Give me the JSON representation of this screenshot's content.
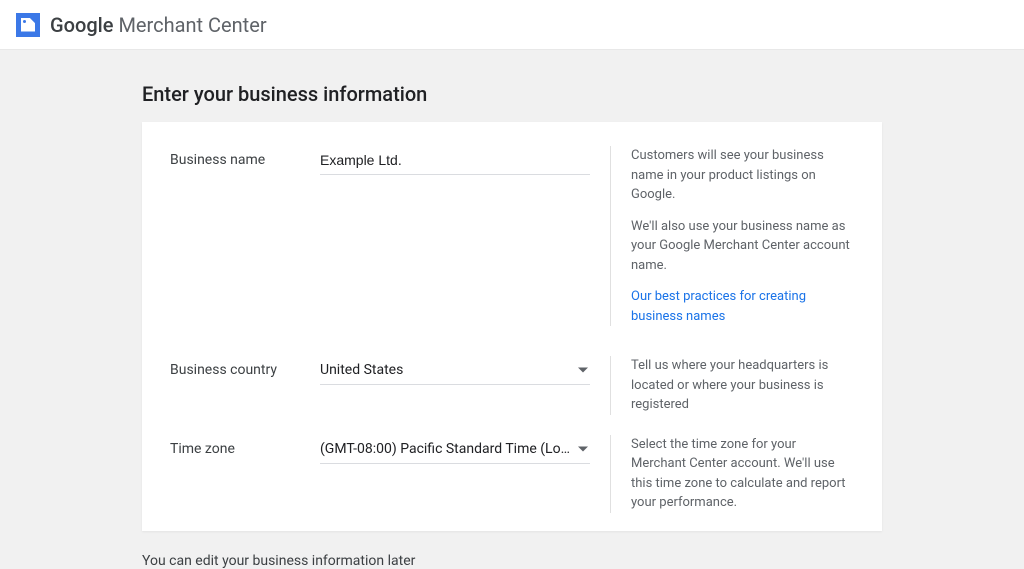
{
  "header": {
    "brand_strong": "Google",
    "brand_light": "Merchant Center"
  },
  "page": {
    "title": "Enter your business information"
  },
  "form": {
    "businessName": {
      "label": "Business name",
      "value": "Example Ltd.",
      "help1": "Customers will see your business name in your product listings on Google.",
      "help2": "We'll also use your business name as your Google Merchant Center account name.",
      "link": "Our best practices for creating business names"
    },
    "businessCountry": {
      "label": "Business country",
      "value": "United States",
      "help": "Tell us where your headquarters is located or where your business is registered"
    },
    "timeZone": {
      "label": "Time zone",
      "value": "(GMT-08:00) Pacific Standard Time (Lo...",
      "help": "Select the time zone for your Merchant Center account. We'll use this time zone to calculate and report your performance."
    }
  },
  "footer": {
    "note": "You can edit your business information later"
  }
}
